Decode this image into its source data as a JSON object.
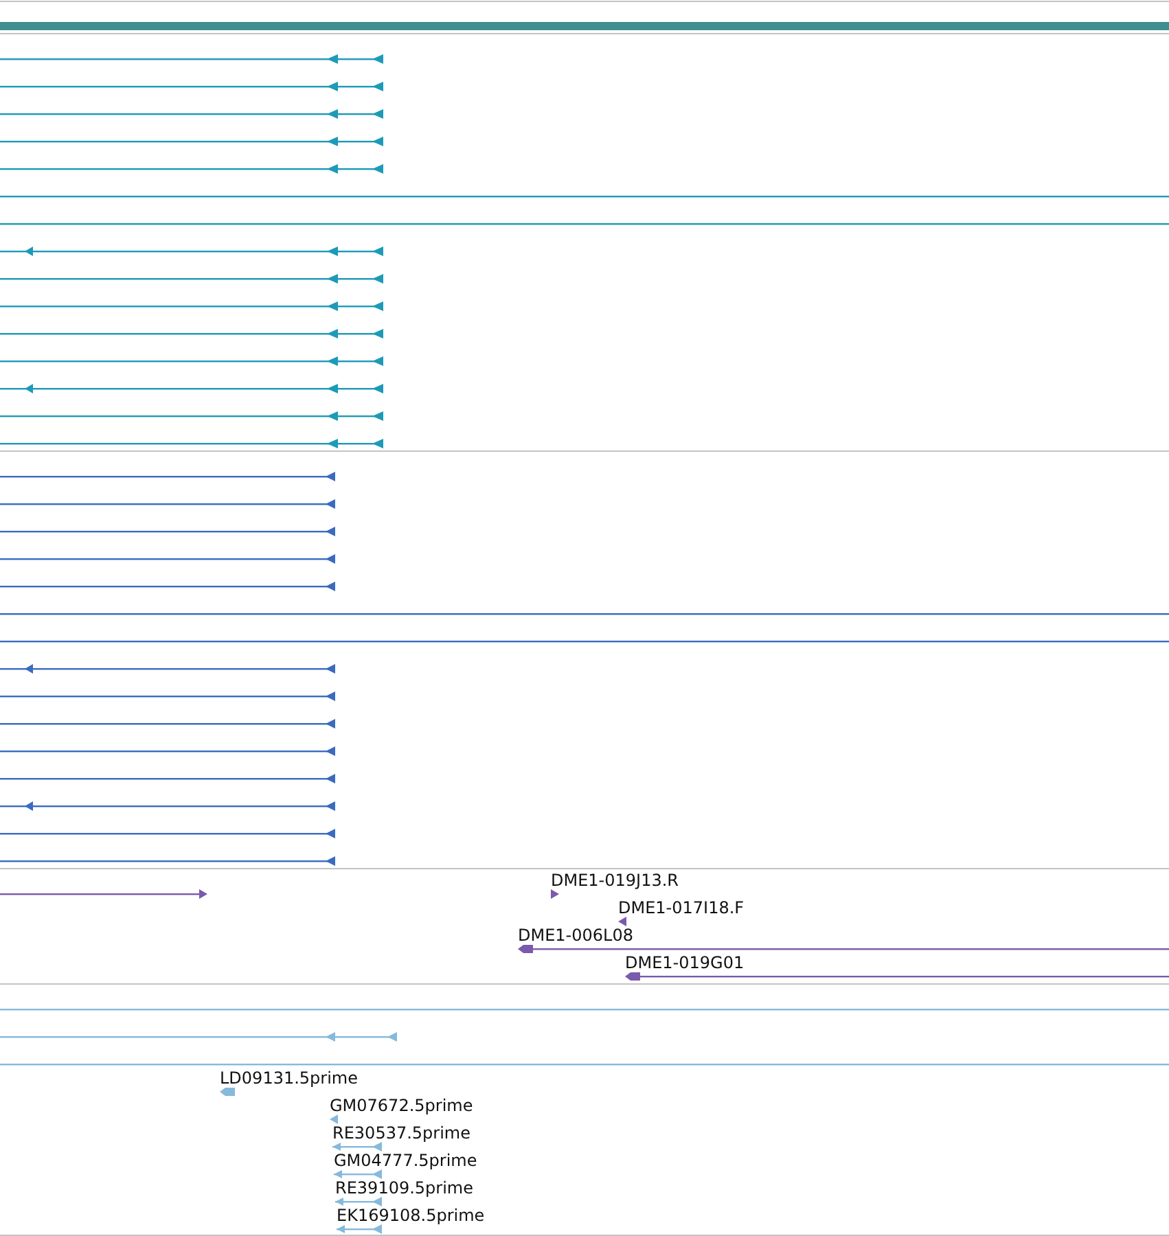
{
  "tracks": [
    {
      "color": "#1d9ab8",
      "features": [
        {
          "kind": "gene"
        },
        {
          "kind": "gene"
        },
        {
          "kind": "gene"
        },
        {
          "kind": "gene"
        },
        {
          "kind": "gene"
        },
        {
          "kind": "through"
        },
        {
          "kind": "through"
        },
        {
          "kind": "gene-long"
        },
        {
          "kind": "gene"
        },
        {
          "kind": "gene"
        },
        {
          "kind": "gene"
        },
        {
          "kind": "gene"
        },
        {
          "kind": "gene-long"
        },
        {
          "kind": "gene"
        },
        {
          "kind": "gene"
        }
      ]
    },
    {
      "color": "#3a6bc1",
      "features": [
        {
          "kind": "gene"
        },
        {
          "kind": "gene"
        },
        {
          "kind": "gene"
        },
        {
          "kind": "gene"
        },
        {
          "kind": "gene"
        },
        {
          "kind": "through"
        },
        {
          "kind": "through"
        },
        {
          "kind": "gene-long"
        },
        {
          "kind": "gene"
        },
        {
          "kind": "gene"
        },
        {
          "kind": "gene"
        },
        {
          "kind": "gene"
        },
        {
          "kind": "gene-long"
        },
        {
          "kind": "gene"
        },
        {
          "kind": "gene"
        }
      ]
    },
    {
      "color": "#7a5aad",
      "features": [
        {
          "kind": "forward"
        },
        {
          "kind": "forward",
          "label": "DME1-019J13.R"
        },
        {
          "kind": "reverse",
          "label": "DME1-017I18.F"
        },
        {
          "kind": "reverse",
          "label": "DME1-006L08"
        },
        {
          "kind": "reverse",
          "label": "DME1-019G01"
        }
      ]
    },
    {
      "color": "#86b9dc",
      "features": [
        {
          "kind": "through"
        },
        {
          "kind": "gene"
        },
        {
          "kind": "through"
        },
        {
          "kind": "reverse",
          "label": "LD09131.5prime"
        },
        {
          "kind": "reverse",
          "label": "GM07672.5prime"
        },
        {
          "kind": "reverse",
          "label": "RE30537.5prime"
        },
        {
          "kind": "reverse",
          "label": "GM04777.5prime"
        },
        {
          "kind": "reverse",
          "label": "RE39109.5prime"
        },
        {
          "kind": "reverse",
          "label": "EK169108.5prime"
        }
      ]
    }
  ]
}
